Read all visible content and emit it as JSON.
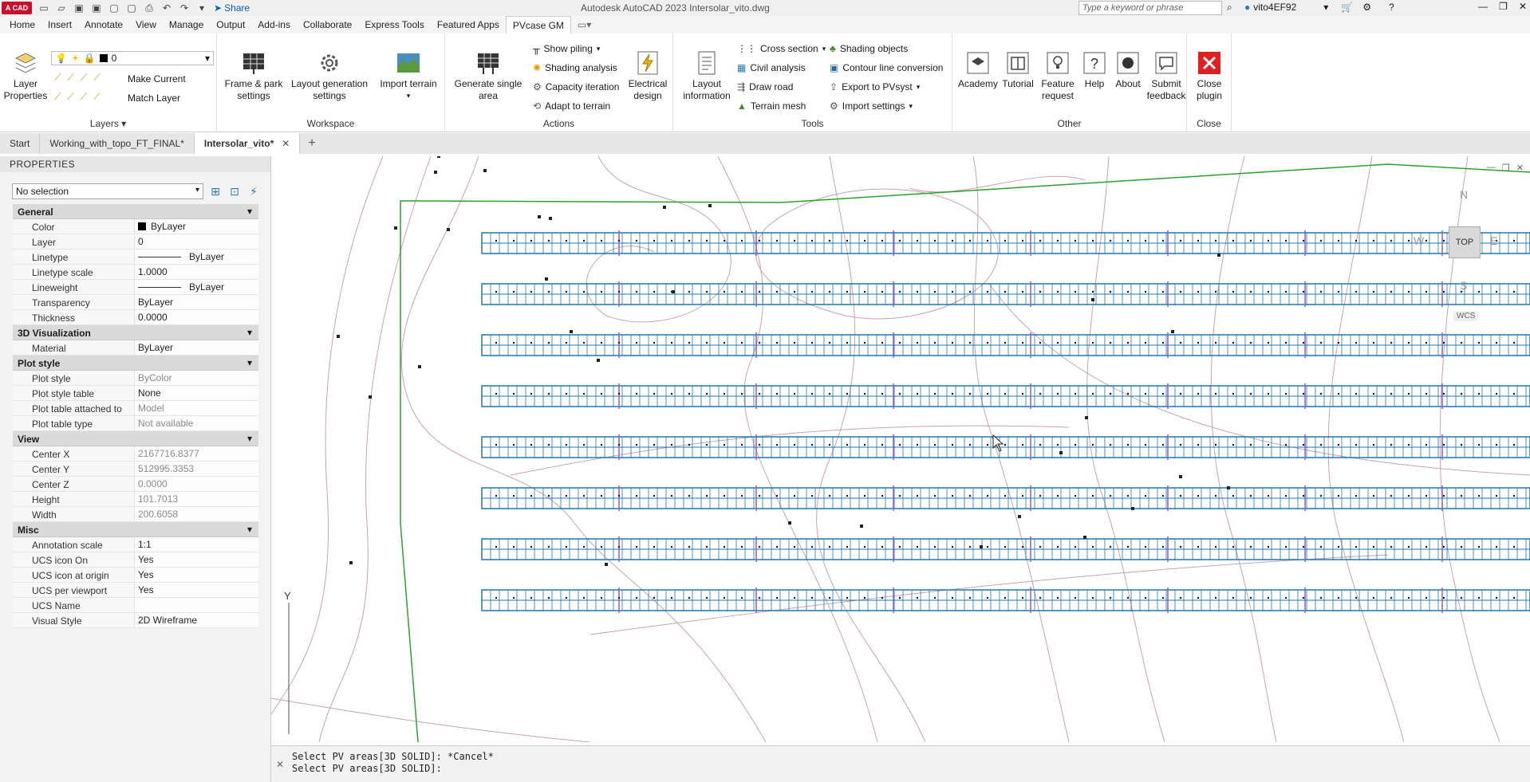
{
  "titlebar": {
    "logo": "A CAD",
    "share_label": "Share",
    "app_title": "Autodesk AutoCAD 2023   Intersolar_vito.dwg",
    "search_placeholder": "Type a keyword or phrase",
    "user": "vito4EF92"
  },
  "ribbon_tabs": [
    "Home",
    "Insert",
    "Annotate",
    "View",
    "Manage",
    "Output",
    "Add-ins",
    "Collaborate",
    "Express Tools",
    "Featured Apps",
    "PVcase GM"
  ],
  "ribbon_active_tab": "PVcase GM",
  "ribbon": {
    "layers": {
      "title": "Layers",
      "layer_properties": "Layer\nProperties",
      "layer_value": "0",
      "make_current": "Make Current",
      "match_layer": "Match Layer"
    },
    "workspace": {
      "title": "Workspace",
      "frame_park": "Frame & park\nsettings",
      "layout_gen": "Layout generation\nsettings",
      "import_terrain": "Import terrain"
    },
    "actions": {
      "title": "Actions",
      "generate_single": "Generate single\narea",
      "show_piling": "Show piling",
      "shading_analysis": "Shading analysis",
      "capacity_iteration": "Capacity iteration",
      "adapt_to_terrain": "Adapt to terrain",
      "electrical_design": "Electrical\ndesign"
    },
    "tools": {
      "title": "Tools",
      "layout_information": "Layout\ninformation",
      "cross_section": "Cross section",
      "civil_analysis": "Civil analysis",
      "draw_road": "Draw road",
      "terrain_mesh": "Terrain mesh",
      "shading_objects": "Shading objects",
      "contour_line": "Contour line conversion",
      "export_pvsyst": "Export to PVsyst",
      "import_settings": "Import settings"
    },
    "other": {
      "title": "Other",
      "academy": "Academy",
      "tutorial": "Tutorial",
      "feature_request": "Feature\nrequest",
      "help": "Help",
      "about": "About",
      "submit_feedback": "Submit\nfeedback"
    },
    "close": {
      "title": "Close",
      "close_plugin": "Close\nplugin"
    }
  },
  "file_tabs": [
    {
      "label": "Start",
      "active": false
    },
    {
      "label": "Working_with_topo_FT_FINAL*",
      "active": false
    },
    {
      "label": "Intersolar_vito*",
      "active": true
    }
  ],
  "properties": {
    "title": "PROPERTIES",
    "selection": "No selection",
    "sections": [
      {
        "name": "General",
        "rows": [
          {
            "name": "Color",
            "value": "ByLayer",
            "swatch": true
          },
          {
            "name": "Layer",
            "value": "0"
          },
          {
            "name": "Linetype",
            "value": "ByLayer",
            "line": true
          },
          {
            "name": "Linetype scale",
            "value": "1.0000"
          },
          {
            "name": "Lineweight",
            "value": "ByLayer",
            "line": true
          },
          {
            "name": "Transparency",
            "value": "ByLayer"
          },
          {
            "name": "Thickness",
            "value": "0.0000"
          }
        ]
      },
      {
        "name": "3D Visualization",
        "rows": [
          {
            "name": "Material",
            "value": "ByLayer"
          }
        ]
      },
      {
        "name": "Plot style",
        "rows": [
          {
            "name": "Plot style",
            "value": "ByColor",
            "gray": true
          },
          {
            "name": "Plot style table",
            "value": "None"
          },
          {
            "name": "Plot table attached to",
            "value": "Model",
            "gray": true
          },
          {
            "name": "Plot table type",
            "value": "Not available",
            "gray": true
          }
        ]
      },
      {
        "name": "View",
        "rows": [
          {
            "name": "Center X",
            "value": "2167716.8377",
            "gray": true
          },
          {
            "name": "Center Y",
            "value": "512995.3353",
            "gray": true
          },
          {
            "name": "Center Z",
            "value": "0.0000",
            "gray": true
          },
          {
            "name": "Height",
            "value": "101.7013",
            "gray": true
          },
          {
            "name": "Width",
            "value": "200.6058",
            "gray": true
          }
        ]
      },
      {
        "name": "Misc",
        "rows": [
          {
            "name": "Annotation scale",
            "value": "1:1"
          },
          {
            "name": "UCS icon On",
            "value": "Yes"
          },
          {
            "name": "UCS icon at origin",
            "value": "Yes"
          },
          {
            "name": "UCS per viewport",
            "value": "Yes"
          },
          {
            "name": "UCS Name",
            "value": ""
          },
          {
            "name": "Visual Style",
            "value": "2D Wireframe"
          }
        ]
      }
    ]
  },
  "viewcube": {
    "face": "TOP",
    "north": "N",
    "south": "S",
    "east": "E",
    "west": "W",
    "wcs": "WCS"
  },
  "ucs_axis": "Y",
  "command_lines": [
    "Select PV areas[3D SOLID]: *Cancel*",
    "Select PV areas[3D SOLID]:"
  ],
  "colors": {
    "pv_blue": "#1f77b4",
    "boundary_green": "#2ca02c",
    "contour": "#c9a1ad",
    "close_red": "#e02020"
  },
  "pv_rows": 8
}
